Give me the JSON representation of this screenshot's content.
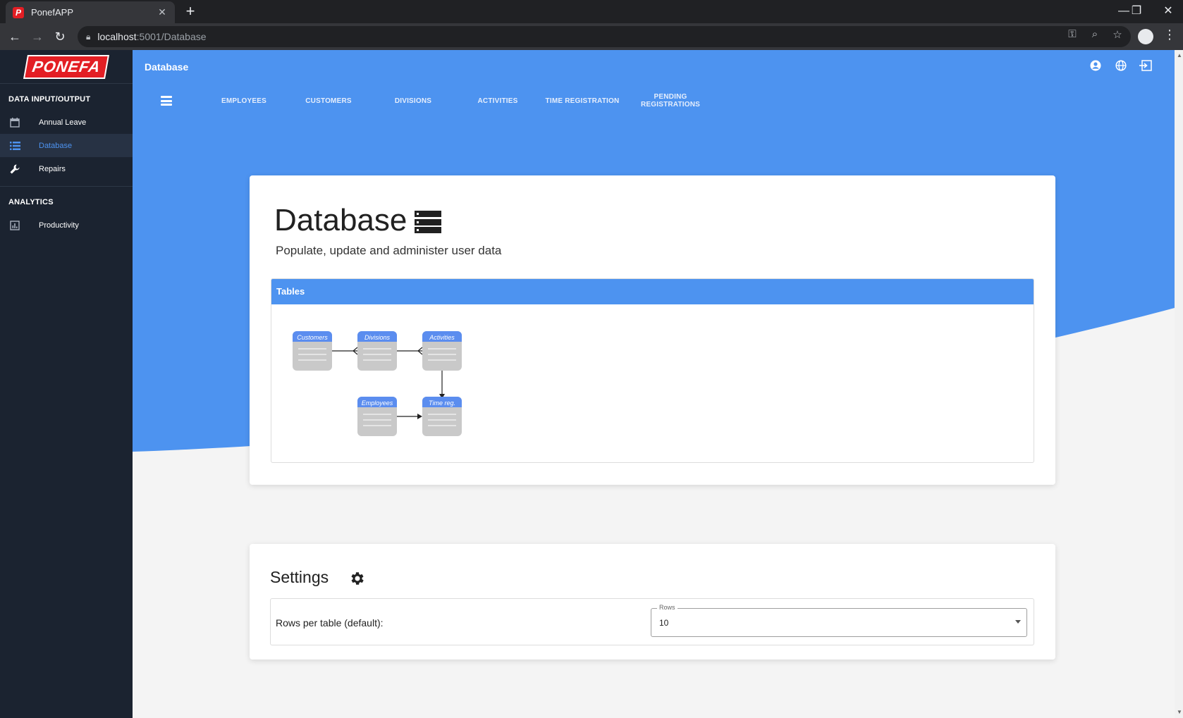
{
  "browser": {
    "tab_title": "PonefAPP",
    "tab_favicon": "P",
    "tab_close": "✕",
    "new_tab": "+",
    "url_host": "localhost",
    "url_path": ":5001/Database",
    "controls": {
      "minimize": "—",
      "restore": "❐",
      "close": "✕"
    }
  },
  "sidebar": {
    "logo_text": "PONEFA",
    "sections": [
      {
        "title": "DATA INPUT/OUTPUT"
      },
      {
        "title": "ANALYTICS"
      }
    ],
    "items": [
      {
        "label": "Annual Leave",
        "icon": "calendar-icon"
      },
      {
        "label": "Database",
        "icon": "list-icon",
        "active": true
      },
      {
        "label": "Repairs",
        "icon": "wrench-icon"
      },
      {
        "label": "Productivity",
        "icon": "chart-icon"
      }
    ]
  },
  "header": {
    "title": "Database",
    "tabs": [
      "EMPLOYEES",
      "CUSTOMERS",
      "DIVISIONS",
      "ACTIVITIES",
      "TIME REGISTRATION",
      "PENDING REGISTRATIONS"
    ]
  },
  "database_card": {
    "title": "Database",
    "subtitle": "Populate, update and administer user data",
    "tables_header": "Tables",
    "diagram_nodes": [
      "Customers",
      "Divisions",
      "Activities",
      "Employees",
      "Time reg."
    ]
  },
  "settings_card": {
    "title": "Settings",
    "rows_label": "Rows per table (default):",
    "rows_legend": "Rows",
    "rows_value": "10"
  },
  "colors": {
    "primary": "#4d93f0",
    "sidebar_bg": "#1b2330",
    "logo_red": "#e31e24",
    "node_header": "#5b8def",
    "node_body": "#c9c9c9"
  }
}
